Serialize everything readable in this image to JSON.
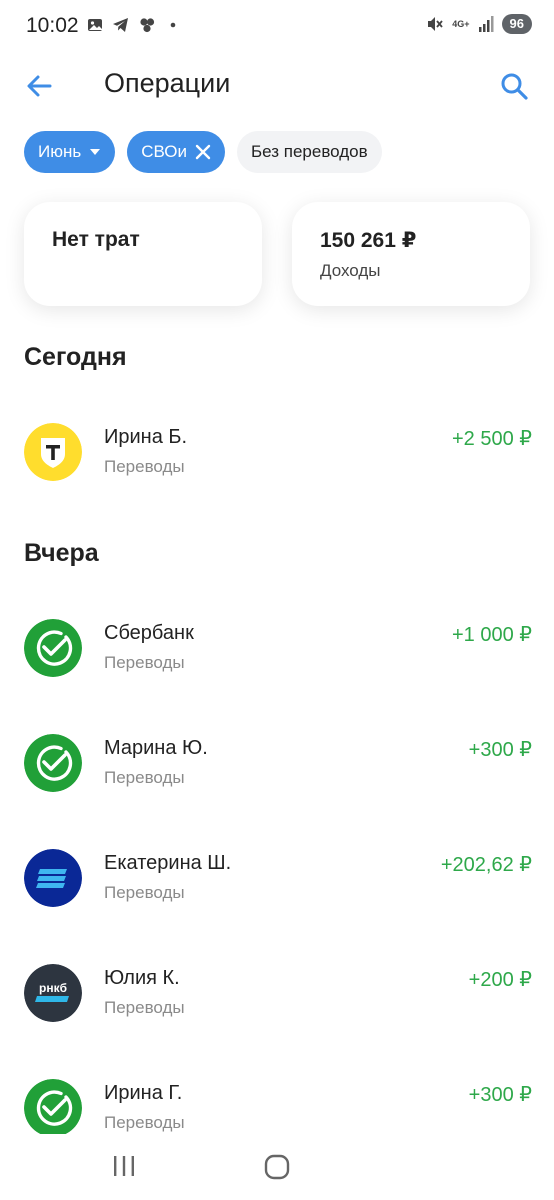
{
  "status_bar": {
    "time": "10:02",
    "network": "4G+",
    "battery": "96"
  },
  "header": {
    "title": "Операции",
    "back_icon": "arrow-left-icon",
    "search_icon": "search-icon"
  },
  "filters": {
    "month": "Июнь",
    "category": "СВОи",
    "no_transfers": "Без переводов"
  },
  "summary": {
    "expenses_label": "Нет трат",
    "income_amount": "150 261 ₽",
    "income_label": "Доходы"
  },
  "sections": {
    "today": "Сегодня",
    "yesterday": "Вчера"
  },
  "transactions": [
    {
      "name": "Ирина Б.",
      "category": "Переводы",
      "amount": "+2 500 ₽",
      "bank": "tbank"
    },
    {
      "name": "Сбербанк",
      "category": "Переводы",
      "amount": "+1 000 ₽",
      "bank": "sber"
    },
    {
      "name": "Марина Ю.",
      "category": "Переводы",
      "amount": "+300 ₽",
      "bank": "sber"
    },
    {
      "name": "Екатерина Ш.",
      "category": "Переводы",
      "amount": "+202,62 ₽",
      "bank": "vtb"
    },
    {
      "name": "Юлия К.",
      "category": "Переводы",
      "amount": "+200 ₽",
      "bank": "rncb",
      "bank_logo_text": "рнкб"
    },
    {
      "name": "Ирина Г.",
      "category": "Переводы",
      "amount": "+300 ₽",
      "bank": "sber"
    }
  ],
  "colors": {
    "accent": "#3f8de6",
    "income": "#2ea84a",
    "sber": "#21a038",
    "tbank": "#ffdd2d",
    "vtb": "#0a2896",
    "rncb": "#2d3540"
  }
}
